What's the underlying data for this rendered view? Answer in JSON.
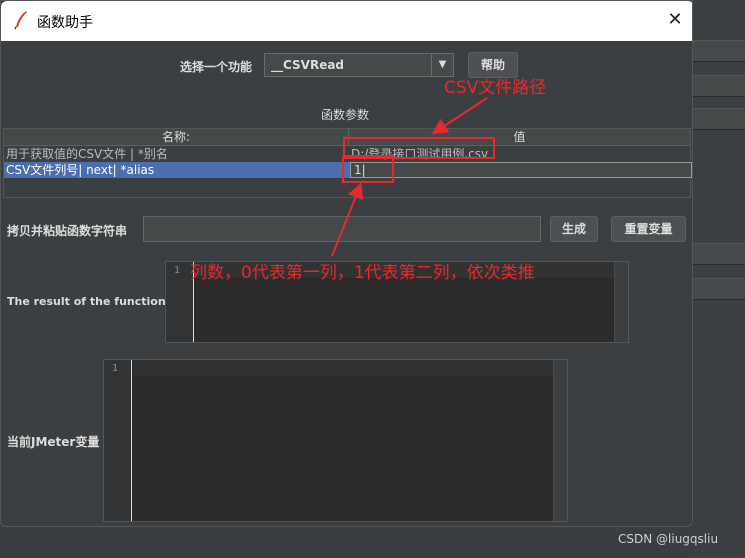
{
  "dialog": {
    "title": "函数助手",
    "close_glyph": "✕"
  },
  "function_select": {
    "label": "选择一个功能",
    "selected": "__CSVRead",
    "help_label": "帮助"
  },
  "params": {
    "section_title": "函数参数",
    "headers": [
      "名称:",
      "值"
    ],
    "rows": [
      {
        "name": "用于获取值的CSV文件 | *别名",
        "value": "D:/登录接口测试用例.csv"
      },
      {
        "name": "CSV文件列号| next| *alias",
        "value": "1"
      }
    ]
  },
  "copy_field": {
    "label": "拷贝并粘贴函数字符串",
    "value": "",
    "generate_label": "生成",
    "reset_label": "重置变量"
  },
  "result": {
    "label": "The result of the function is",
    "line_number": "1"
  },
  "variables": {
    "label": "当前JMeter变量",
    "line_number": "1"
  },
  "annotations": {
    "csv_path": "CSV文件路径",
    "column_note": "列数，0代表第一列，1代表第二列，依次类推",
    "color": "#e8282b"
  },
  "watermark": "CSDN @liugqsliu"
}
